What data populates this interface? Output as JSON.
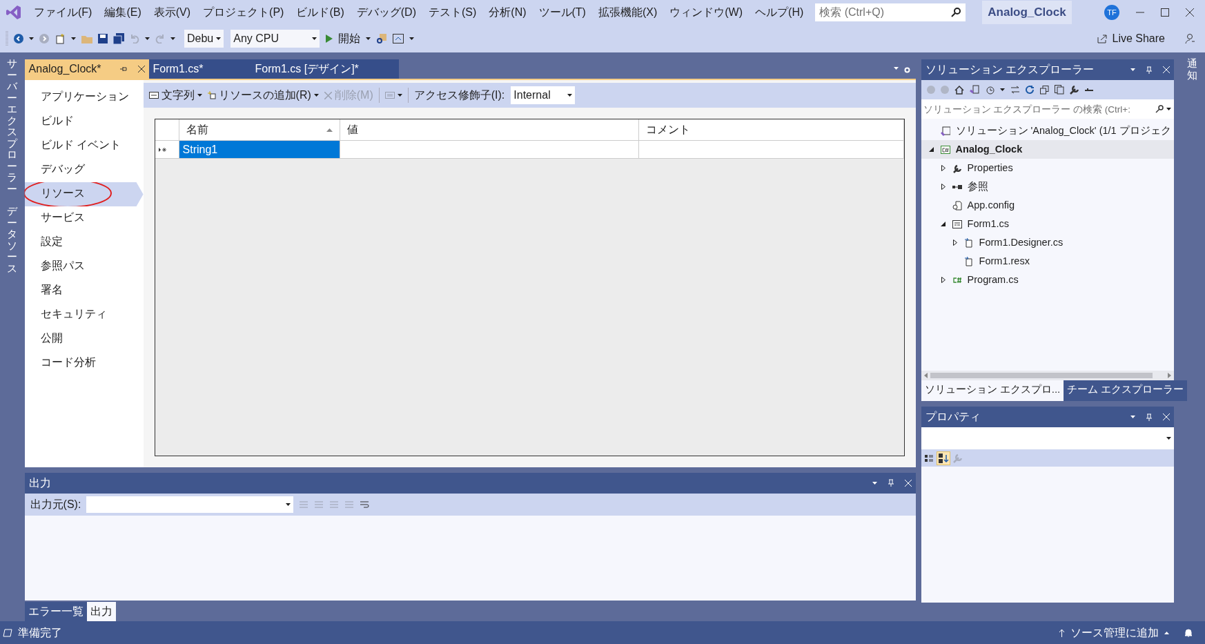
{
  "menu": [
    "ファイル(F)",
    "編集(E)",
    "表示(V)",
    "プロジェクト(P)",
    "ビルド(B)",
    "デバッグ(D)",
    "テスト(S)",
    "分析(N)",
    "ツール(T)",
    "拡張機能(X)",
    "ウィンドウ(W)",
    "ヘルプ(H)"
  ],
  "search": {
    "placeholder": "検索 (Ctrl+Q)"
  },
  "project_name": "Analog_Clock",
  "user_initials": "TF",
  "toolbar": {
    "configuration": "Debu",
    "platform": "Any CPU",
    "start": "開始",
    "live_share": "Live Share"
  },
  "left_strip": [
    "サーバーエクスプローラー",
    "データソース"
  ],
  "right_strip": [
    "通知"
  ],
  "document_tabs": [
    {
      "label": "Analog_Clock*",
      "selected": true
    },
    {
      "label": "Form1.cs*",
      "selected": false
    },
    {
      "label": "Form1.cs [デザイン]*",
      "selected": false
    }
  ],
  "project_nav": [
    {
      "label": "アプリケーション",
      "selected": false,
      "circled": false
    },
    {
      "label": "ビルド",
      "selected": false,
      "circled": false
    },
    {
      "label": "ビルド イベント",
      "selected": false,
      "circled": false
    },
    {
      "label": "デバッグ",
      "selected": false,
      "circled": false
    },
    {
      "label": "リソース",
      "selected": true,
      "circled": true
    },
    {
      "label": "サービス",
      "selected": false,
      "circled": false
    },
    {
      "label": "設定",
      "selected": false,
      "circled": false
    },
    {
      "label": "参照パス",
      "selected": false,
      "circled": false
    },
    {
      "label": "署名",
      "selected": false,
      "circled": false
    },
    {
      "label": "セキュリティ",
      "selected": false,
      "circled": false
    },
    {
      "label": "公開",
      "selected": false,
      "circled": false
    },
    {
      "label": "コード分析",
      "selected": false,
      "circled": false
    }
  ],
  "resource_toolbar": {
    "type_button": "文字列",
    "add_button": "リソースの追加(R)",
    "delete_button": {
      "label": "削除(M)",
      "disabled": true
    },
    "access_label": "アクセス修飾子(I):",
    "access_value": "Internal"
  },
  "resource_table": {
    "columns": [
      {
        "label": "名前",
        "sorted": true
      },
      {
        "label": "値",
        "sorted": false
      },
      {
        "label": "コメント",
        "sorted": false
      }
    ],
    "rows": [
      {
        "cells": [
          {
            "text": "String1",
            "selected": true
          },
          {
            "selected": false
          },
          {
            "selected": false
          }
        ]
      }
    ]
  },
  "output": {
    "title": "出力",
    "source_label": "出力元(S):"
  },
  "bottom_tabs": [
    {
      "label": "エラー一覧",
      "selected": false
    },
    {
      "label": "出力",
      "selected": true
    }
  ],
  "solution_explorer": {
    "title": "ソリューション エクスプローラー",
    "search_placeholder": "ソリューション エクスプローラー の検索 (Ctrl+:",
    "tree": [
      {
        "label": "ソリューション 'Analog_Clock' (1/1 プロジェク",
        "kind": "solution",
        "selected": false,
        "bold": false
      },
      {
        "label": "Analog_Clock",
        "kind": "project",
        "selected": true,
        "bold": true,
        "expanded": true,
        "children": [
          {
            "label": "Properties",
            "kind": "properties",
            "selected": false,
            "bold": false,
            "expanded": false
          },
          {
            "label": "参照",
            "kind": "references",
            "selected": false,
            "bold": false,
            "expanded": false
          },
          {
            "label": "App.config",
            "kind": "config",
            "selected": false,
            "bold": false
          },
          {
            "label": "Form1.cs",
            "kind": "form",
            "selected": false,
            "bold": false,
            "expanded": true,
            "children": [
              {
                "label": "Form1.Designer.cs",
                "kind": "file",
                "selected": false,
                "bold": false,
                "expanded": false
              },
              {
                "label": "Form1.resx",
                "kind": "file",
                "selected": false,
                "bold": false
              }
            ]
          },
          {
            "label": "Program.cs",
            "kind": "code",
            "selected": false,
            "bold": false,
            "expanded": false
          }
        ]
      }
    ]
  },
  "explorer_tabs": [
    {
      "label": "ソリューション エクスプロ...",
      "selected": true
    },
    {
      "label": "チーム エクスプローラー",
      "selected": false
    }
  ],
  "properties": {
    "title": "プロパティ"
  },
  "status_bar": {
    "text": "準備完了",
    "source_control": "ソース管理に追加"
  }
}
